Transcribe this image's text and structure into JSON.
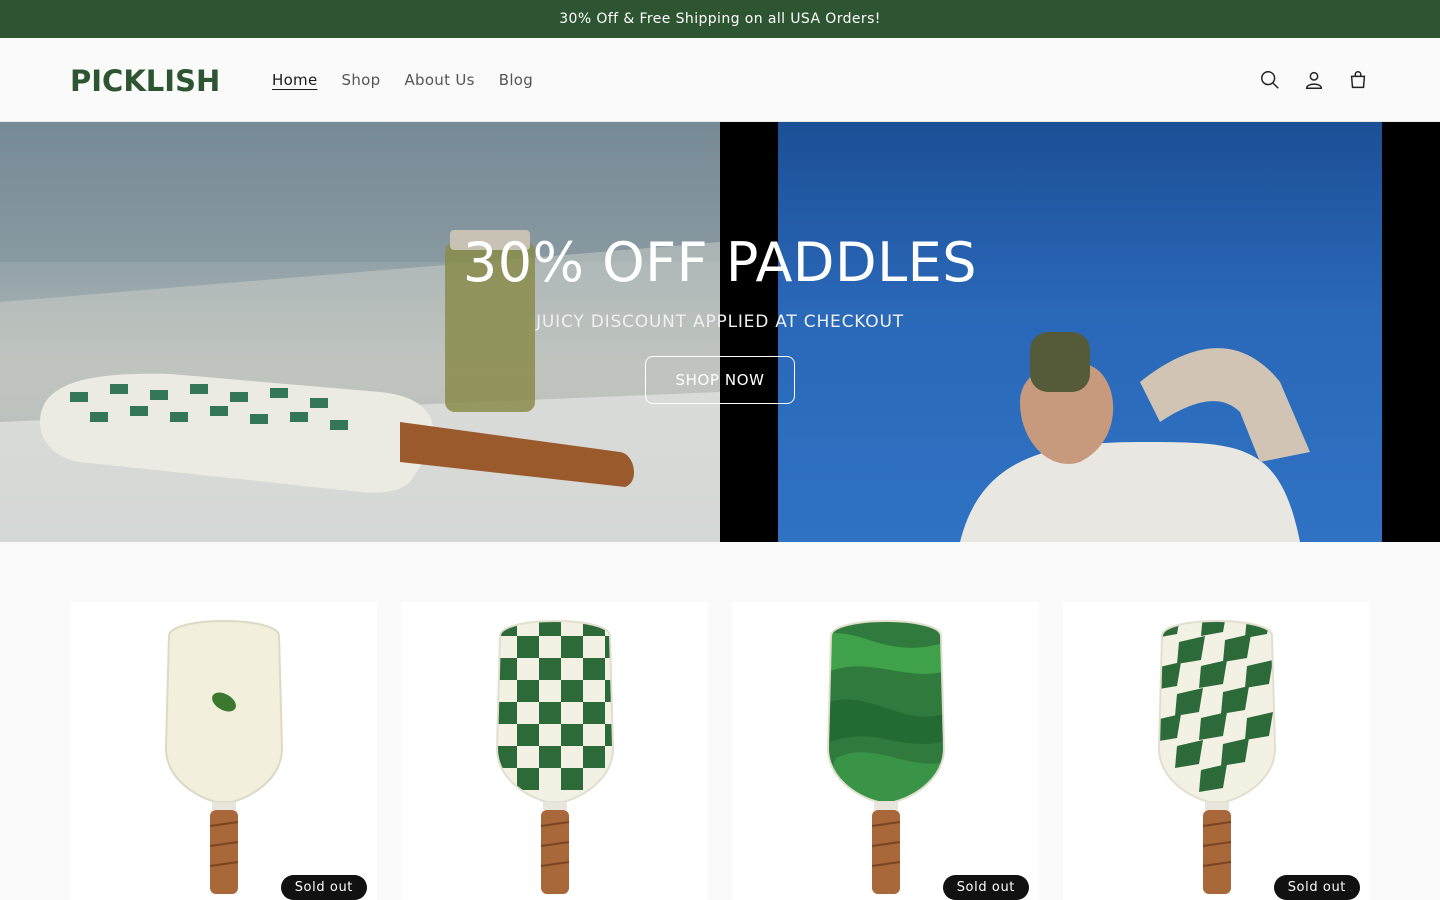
{
  "announcement": {
    "text": "30% Off & Free Shipping on all USA Orders!"
  },
  "header": {
    "logo_text": "PICKLISH",
    "nav": [
      {
        "label": "Home",
        "active": true
      },
      {
        "label": "Shop",
        "active": false
      },
      {
        "label": "About Us",
        "active": false
      },
      {
        "label": "Blog",
        "active": false
      }
    ],
    "icons": [
      "search-icon",
      "account-icon",
      "cart-icon"
    ]
  },
  "hero": {
    "title": "30% OFF PADDLES",
    "subtitle": "JUICY DISCOUNT APPLIED AT CHECKOUT",
    "cta_label": "SHOP NOW"
  },
  "products": [
    {
      "pattern": "solid-cream-pickle",
      "badge": "Sold out"
    },
    {
      "pattern": "green-checker",
      "badge": ""
    },
    {
      "pattern": "green-swirl",
      "badge": "Sold out"
    },
    {
      "pattern": "warped-checker",
      "badge": "Sold out"
    }
  ],
  "colors": {
    "brand_green": "#2e5532",
    "badge_bg": "#111111",
    "accent_blue": "#2a68b8"
  }
}
